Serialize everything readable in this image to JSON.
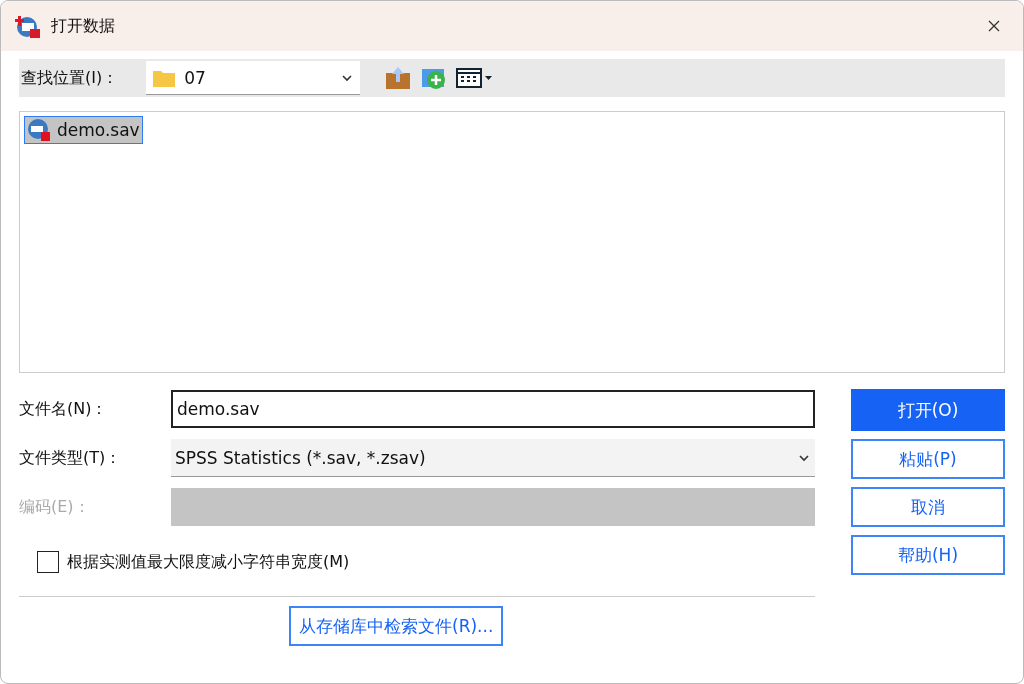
{
  "window": {
    "title": "打开数据"
  },
  "look_in": {
    "label": "查找位置(I)：",
    "value": "07"
  },
  "files": [
    {
      "name": "demo.sav",
      "selected": true
    }
  ],
  "fields": [
    {
      "kind": "text",
      "label": "文件名(N)：",
      "value": "demo.sav",
      "disabled": false
    },
    {
      "kind": "select",
      "label": "文件类型(T)：",
      "value": "SPSS Statistics (*.sav, *.zsav)",
      "disabled": false
    },
    {
      "kind": "select",
      "label": "编码(E)：",
      "disabled": true
    }
  ],
  "checkbox": {
    "label": "根据实测值最大限度减小字符串宽度(M)",
    "checked": false
  },
  "buttons": [
    {
      "label": "打开(O)",
      "primary": true
    },
    {
      "label": "粘贴(P)",
      "primary": false
    },
    {
      "label": "取消",
      "primary": false
    },
    {
      "label": "帮助(H)",
      "primary": false
    }
  ],
  "repository_button": "从存储库中检索文件(R)..."
}
